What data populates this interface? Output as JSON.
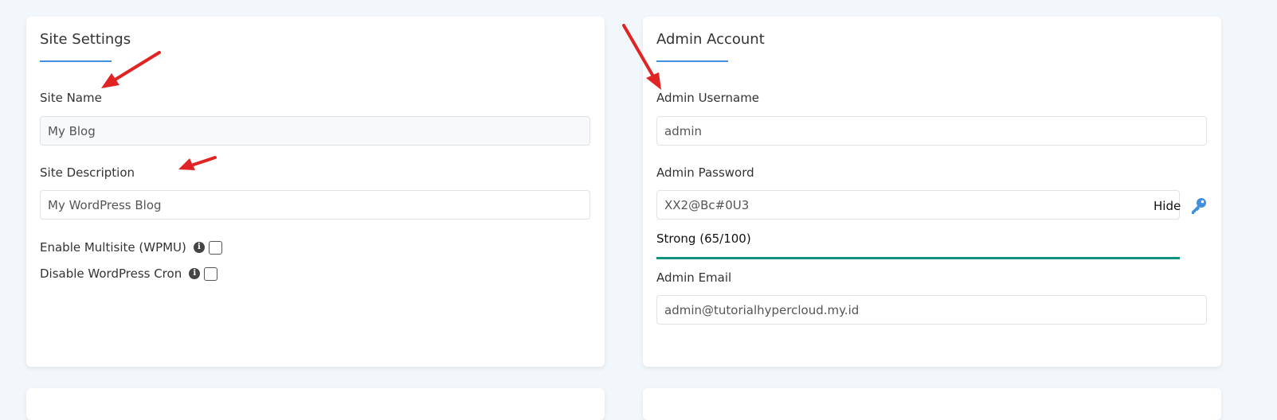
{
  "site_settings": {
    "title": "Site Settings",
    "site_name_label": "Site Name",
    "site_name_value": "My Blog",
    "site_description_label": "Site Description",
    "site_description_value": "My WordPress Blog",
    "enable_multisite_label": "Enable Multisite (WPMU)",
    "enable_multisite_checked": false,
    "disable_cron_label": "Disable WordPress Cron",
    "disable_cron_checked": false
  },
  "admin_account": {
    "title": "Admin Account",
    "username_label": "Admin Username",
    "username_value": "admin",
    "password_label": "Admin Password",
    "password_value": "XX2@Bc#0U3",
    "hide_label": "Hide",
    "strength_text": "Strong (65/100)",
    "strength_score": 65,
    "strength_color": "#13937f",
    "email_label": "Admin Email",
    "email_value": "admin@tutorialhypercloud.my.id"
  },
  "icons": {
    "info": "info-icon",
    "key": "key-icon"
  },
  "colors": {
    "accent": "#3f8fde",
    "annotation_arrow": "#e02424"
  }
}
